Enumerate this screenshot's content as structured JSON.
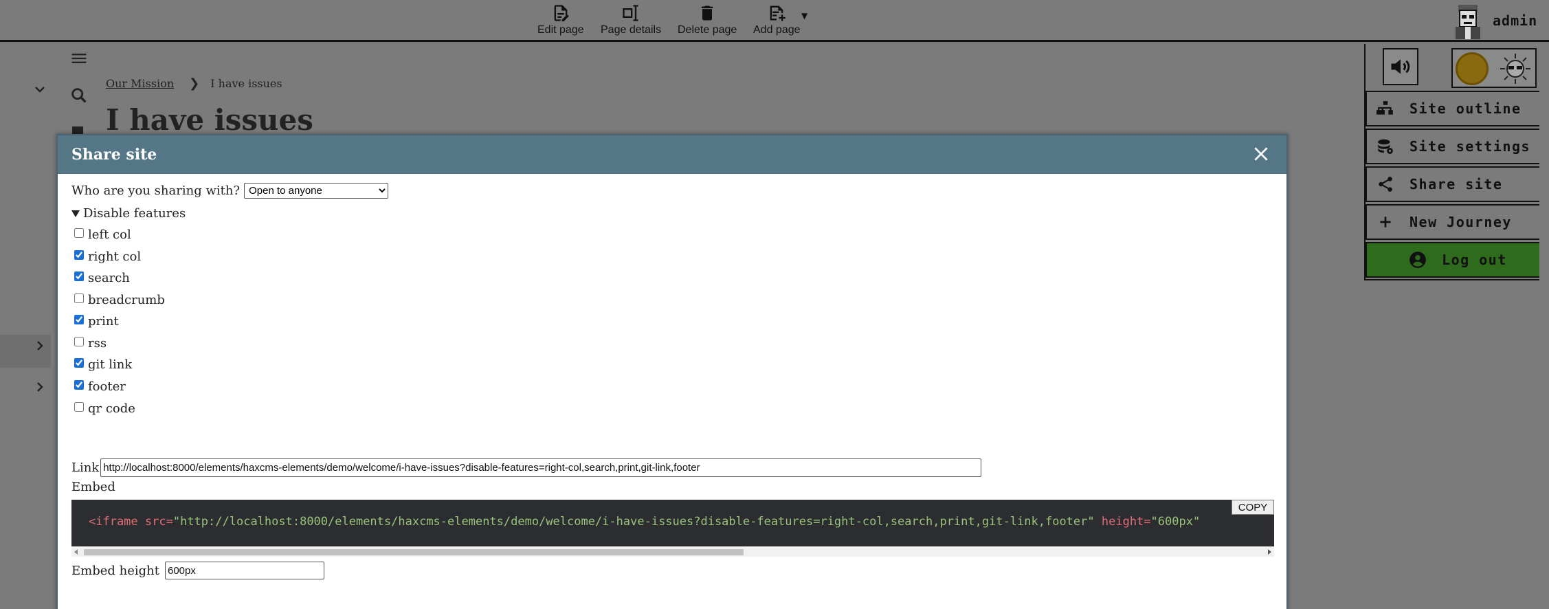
{
  "toolbar": {
    "edit_label": "Edit page",
    "details_label": "Page details",
    "delete_label": "Delete page",
    "add_label": "Add page",
    "user_name": "admin"
  },
  "breadcrumb": {
    "parent": "Our Mission",
    "current": "I have issues"
  },
  "page": {
    "title": "I have issues"
  },
  "site_menu": {
    "items": [
      {
        "label": "Site outline",
        "icon": "sitemap-icon"
      },
      {
        "label": "Site settings",
        "icon": "settings-stack-icon"
      },
      {
        "label": "Share site",
        "icon": "share-icon"
      },
      {
        "label": "New Journey",
        "icon": "plus-icon"
      },
      {
        "label": "Log out",
        "icon": "account-circle-icon"
      }
    ],
    "logout_color": "#2e6b1c"
  },
  "modal": {
    "title": "Share site",
    "sharing_label": "Who are you sharing with?",
    "sharing_selected": "Open to anyone",
    "disable_summary": "Disable features",
    "features": [
      {
        "label": "left col",
        "checked": false
      },
      {
        "label": "right col",
        "checked": true
      },
      {
        "label": "search",
        "checked": true
      },
      {
        "label": "breadcrumb",
        "checked": false
      },
      {
        "label": "print",
        "checked": true
      },
      {
        "label": "rss",
        "checked": false
      },
      {
        "label": "git link",
        "checked": true
      },
      {
        "label": "footer",
        "checked": true
      },
      {
        "label": "qr code",
        "checked": false
      }
    ],
    "link_label": "Link",
    "link_value": "http://localhost:8000/elements/haxcms-elements/demo/welcome/i-have-issues?disable-features=right-col,search,print,git-link,footer",
    "embed_label": "Embed",
    "embed_code": {
      "tag_open": "<iframe",
      "src_attr": "src=",
      "src_value": "\"http://localhost:8000/elements/haxcms-elements/demo/welcome/i-have-issues?disable-features=right-col,search,print,git-link,footer\"",
      "height_attr": "height=",
      "height_value": "\"600px\""
    },
    "copy_label": "COPY",
    "embed_height_label": "Embed height",
    "embed_height_value": "600px"
  },
  "colors": {
    "header": "#557687",
    "backdrop": "#7b7b7b",
    "code_bg": "#2b2d31",
    "code_tag": "#e06c75",
    "code_string": "#98c379"
  }
}
